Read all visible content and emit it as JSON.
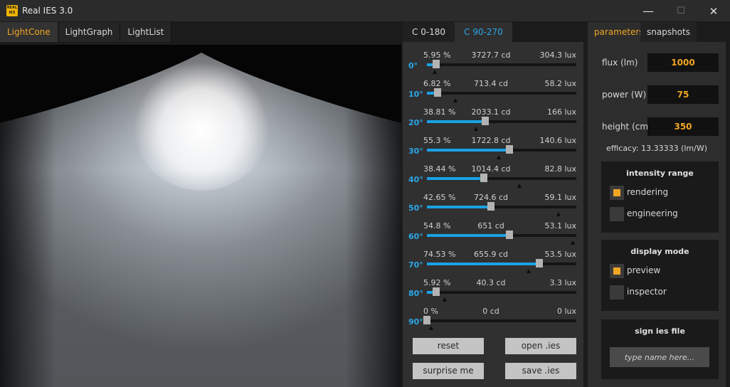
{
  "window": {
    "title": "Real IES 3.0",
    "icon_text": "REAL IES",
    "minimize_glyph": "—",
    "maximize_glyph": "☐",
    "close_glyph": "✕"
  },
  "left_tabs": [
    {
      "label": "LightCone",
      "active": true
    },
    {
      "label": "LightGraph",
      "active": false
    },
    {
      "label": "LightList",
      "active": false
    }
  ],
  "angle_tabs": [
    {
      "label": "C 0-180",
      "active": false
    },
    {
      "label": "C 90-270",
      "active": true
    }
  ],
  "rows": [
    {
      "pct": "5.95 %",
      "cd": "3727.7 cd",
      "lux": "304.3 lux",
      "deg": "0°",
      "value": 0.06,
      "marker": 0.05
    },
    {
      "pct": "6.82 %",
      "cd": "713.4 cd",
      "lux": "58.2 lux",
      "deg": "10°",
      "value": 0.07,
      "marker": 0.19
    },
    {
      "pct": "38.81 %",
      "cd": "2033.1 cd",
      "lux": "166 lux",
      "deg": "20°",
      "value": 0.39,
      "marker": 0.33
    },
    {
      "pct": "55.3 %",
      "cd": "1722.8 cd",
      "lux": "140.6 lux",
      "deg": "30°",
      "value": 0.55,
      "marker": 0.48
    },
    {
      "pct": "38.44 %",
      "cd": "1014.4 cd",
      "lux": "82.8 lux",
      "deg": "40°",
      "value": 0.38,
      "marker": 0.62
    },
    {
      "pct": "42.65 %",
      "cd": "724.6 cd",
      "lux": "59.1 lux",
      "deg": "50°",
      "value": 0.43,
      "marker": 0.88
    },
    {
      "pct": "54.8 %",
      "cd": "651 cd",
      "lux": "53.1 lux",
      "deg": "60°",
      "value": 0.55,
      "marker": 0.975
    },
    {
      "pct": "74.53 %",
      "cd": "655.9 cd",
      "lux": "53.5 lux",
      "deg": "70°",
      "value": 0.75,
      "marker": 0.68
    },
    {
      "pct": "5.92 %",
      "cd": "40.3 cd",
      "lux": "3.3 lux",
      "deg": "80°",
      "value": 0.06,
      "marker": 0.12
    },
    {
      "pct": "0 %",
      "cd": "0 cd",
      "lux": "0 lux",
      "deg": "90°",
      "value": 0.0,
      "marker": 0.03
    }
  ],
  "buttons": {
    "reset": "reset",
    "open": "open .ies",
    "surprise": "surprise me",
    "save": "save .ies"
  },
  "right_tabs": {
    "parameters": "parameters",
    "snapshots": "snapshots"
  },
  "params": {
    "flux_label": "flux (lm)",
    "flux_value": "1000",
    "power_label": "power (W)",
    "power_value": "75",
    "height_label": "height (cm)",
    "height_value": "350",
    "efficacy": "efficacy: 13.33333 (lm/W)"
  },
  "intensity_range": {
    "title": "intensity range",
    "options": [
      {
        "label": "rendering",
        "checked": true
      },
      {
        "label": "engineering",
        "checked": false
      }
    ]
  },
  "display_mode": {
    "title": "display mode",
    "options": [
      {
        "label": "preview",
        "checked": true
      },
      {
        "label": "inspector",
        "checked": false
      }
    ]
  },
  "sign": {
    "title": "sign ies file",
    "placeholder": "type name here..."
  },
  "colors": {
    "accent_orange": "#f1a623",
    "accent_blue": "#2aa7e8",
    "slider_fill": "#19a2e5",
    "background": "#1b1b1b"
  }
}
